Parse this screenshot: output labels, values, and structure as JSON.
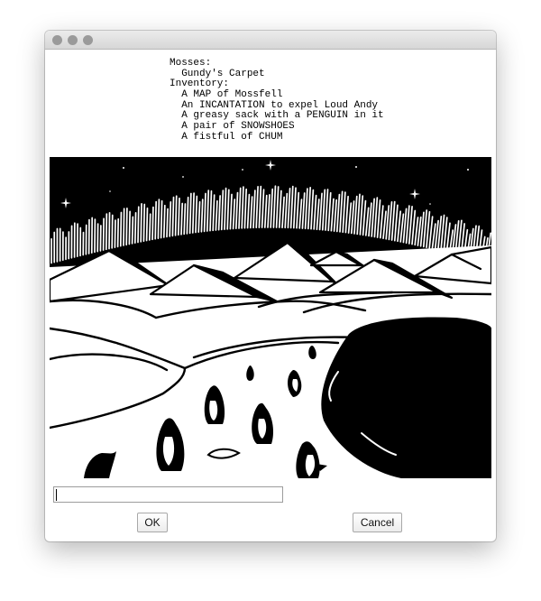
{
  "status_text": {
    "lines": [
      "Mosses:",
      "  Gundy's Carpet",
      "Inventory:",
      "  A MAP of Mossfell",
      "  An INCANTATION to expel Loud Andy",
      "  A greasy sack with a PENGUIN in it",
      "  A pair of SNOWSHOES",
      "  A fistful of CHUM"
    ]
  },
  "command": {
    "value": ""
  },
  "buttons": {
    "ok_label": "OK",
    "cancel_label": "Cancel"
  }
}
